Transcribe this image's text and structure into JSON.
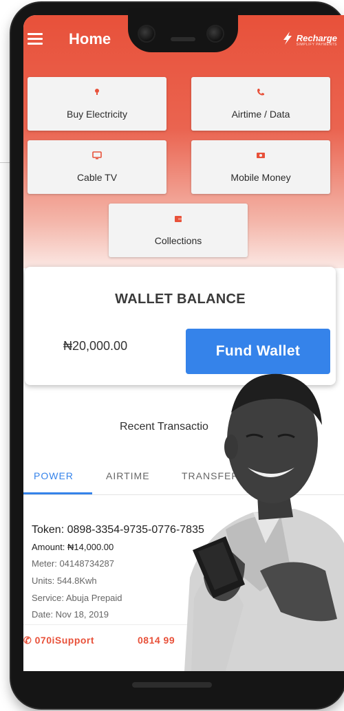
{
  "app": {
    "title": "Home",
    "brand": "Recharge",
    "brand_sub": "SIMPLIFY PAYMENTS"
  },
  "icons": {
    "menu": "hamburger-menu-icon",
    "electricity": "bulb-icon",
    "airtime": "phone-icon",
    "cable": "tv-icon",
    "mobile_money": "money-icon",
    "collections": "wallet-icon",
    "support": "phone-icon"
  },
  "services": {
    "electricity": "Buy Electricity",
    "airtime": "Airtime / Data",
    "cable": "Cable TV",
    "mobile_money": "Mobile Money",
    "collections": "Collections"
  },
  "wallet": {
    "title": "WALLET BALANCE",
    "balance": "₦20,000.00",
    "fund_label": "Fund Wallet"
  },
  "recent": {
    "title": "Recent Transactio"
  },
  "tabs": [
    {
      "label": "POWER",
      "active": true
    },
    {
      "label": "AIRTIME",
      "active": false
    },
    {
      "label": "TRANSFER",
      "active": false
    }
  ],
  "transaction": {
    "token": "Token: 0898-3354-9735-0776-7835",
    "amount": "Amount: ₦14,000.00",
    "meter": "Meter: 04148734287",
    "units": "Units: 544.8Kwh",
    "service": "Service: Abuja Prepaid",
    "date": "Date: Nov 18, 2019"
  },
  "support": {
    "line1": "070iSupport",
    "line2": "0814 99"
  },
  "colors": {
    "accent": "#e8513a",
    "primary": "#3583ea"
  }
}
